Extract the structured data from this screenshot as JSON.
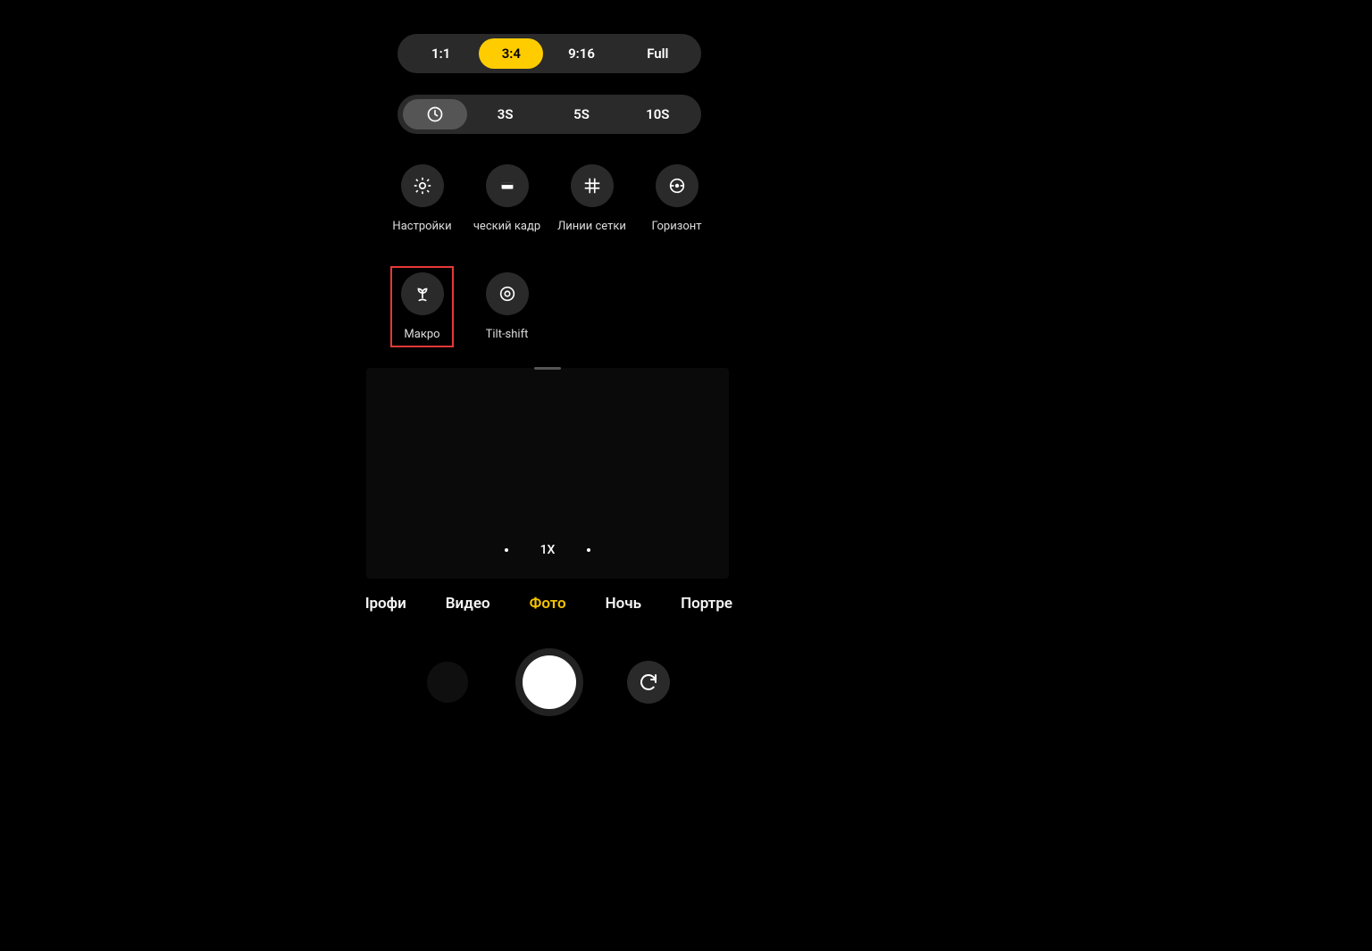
{
  "aspect_ratios": {
    "options": [
      "1:1",
      "3:4",
      "9:16",
      "Full"
    ],
    "active_index": 1
  },
  "timer": {
    "options": [
      "clock",
      "3S",
      "5S",
      "10S"
    ],
    "active_index": 0
  },
  "quick_options": {
    "row1": [
      {
        "id": "settings",
        "label": "Настройки",
        "icon": "gear"
      },
      {
        "id": "smart-frame",
        "label": "ческий кадр",
        "icon": "frame"
      },
      {
        "id": "gridlines",
        "label": "Линии сетки",
        "icon": "grid"
      },
      {
        "id": "horizon",
        "label": "Горизонт",
        "icon": "level"
      }
    ],
    "row2": [
      {
        "id": "macro",
        "label": "Макро",
        "icon": "flower",
        "highlighted": true
      },
      {
        "id": "tilt-shift",
        "label": "Tilt-shift",
        "icon": "target"
      }
    ]
  },
  "zoom": {
    "label": "1X"
  },
  "modes": {
    "items": [
      "Профи",
      "Видео",
      "Фото",
      "Ночь",
      "Портрет"
    ],
    "active_index": 2
  },
  "colors": {
    "accent": "#ffcc00",
    "highlight_border": "#e53935",
    "background": "#000000",
    "pill_bg": "#2a2a2a"
  }
}
